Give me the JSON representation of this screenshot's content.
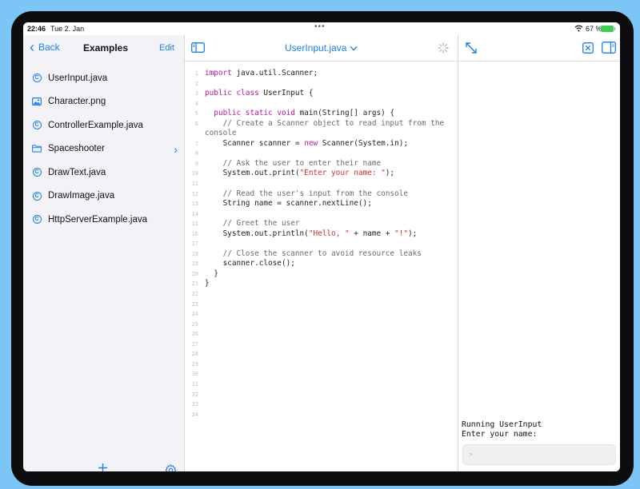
{
  "status_bar": {
    "time": "22:46",
    "date": "Tue 2. Jan",
    "multitask_dots": "•••",
    "battery_percent": "67 %",
    "battery_color": "#3ccf4e",
    "wifi_icon": "wifi-icon",
    "battery_icon": "battery-charging-icon"
  },
  "sidebar": {
    "back_label": "Back",
    "title": "Examples",
    "edit_label": "Edit",
    "items": [
      {
        "label": "UserInput.java",
        "icon": "java-class-icon"
      },
      {
        "label": "Character.png",
        "icon": "image-icon"
      },
      {
        "label": "ControllerExample.java",
        "icon": "java-class-icon"
      },
      {
        "label": "Spaceshooter",
        "icon": "folder-icon",
        "has_chevron": true
      },
      {
        "label": "DrawText.java",
        "icon": "java-class-icon"
      },
      {
        "label": "DrawImage.java",
        "icon": "java-class-icon"
      },
      {
        "label": "HttpServerExample.java",
        "icon": "java-class-icon"
      }
    ],
    "add_icon": "plus-icon",
    "settings_icon": "gear-icon"
  },
  "editor": {
    "filename": "UserInput.java",
    "lines": [
      {
        "n": "1",
        "html": "<span class=\"kw\">import</span> java.util.Scanner;"
      },
      {
        "n": "2",
        "html": ""
      },
      {
        "n": "3",
        "html": "<span class=\"kw\">public class</span> UserInput {"
      },
      {
        "n": "4",
        "html": ""
      },
      {
        "n": "5",
        "html": "  <span class=\"kw\">public static void</span> main(String[] args) {"
      },
      {
        "n": "6",
        "html": "<span class=\"cm\">    // Create a Scanner object to read input from the console</span>",
        "wrap": true
      },
      {
        "n": "7",
        "html": "    Scanner scanner = <span class=\"kw\">new</span> Scanner(System.in);"
      },
      {
        "n": "8",
        "html": ""
      },
      {
        "n": "9",
        "html": "<span class=\"cm\">    // Ask the user to enter their name</span>"
      },
      {
        "n": "10",
        "html": "    System.out.print(<span class=\"st\">\"Enter your name: \"</span>);"
      },
      {
        "n": "11",
        "html": ""
      },
      {
        "n": "12",
        "html": "<span class=\"cm\">    // Read the user's input from the console</span>"
      },
      {
        "n": "13",
        "html": "    String name = scanner.nextLine();"
      },
      {
        "n": "14",
        "html": ""
      },
      {
        "n": "15",
        "html": "<span class=\"cm\">    // Greet the user</span>"
      },
      {
        "n": "16",
        "html": "    System.out.println(<span class=\"st\">\"Hello, \"</span> + name + <span class=\"st\">\"!\"</span>);"
      },
      {
        "n": "17",
        "html": ""
      },
      {
        "n": "18",
        "html": "<span class=\"cm\">    // Close the scanner to avoid resource leaks</span>"
      },
      {
        "n": "19",
        "html": "    scanner.close();"
      },
      {
        "n": "20",
        "html": "  }"
      },
      {
        "n": "21",
        "html": "}"
      },
      {
        "n": "22",
        "html": ""
      },
      {
        "n": "23",
        "html": ""
      },
      {
        "n": "24",
        "html": ""
      },
      {
        "n": "25",
        "html": ""
      },
      {
        "n": "26",
        "html": ""
      },
      {
        "n": "27",
        "html": ""
      },
      {
        "n": "28",
        "html": ""
      },
      {
        "n": "29",
        "html": ""
      },
      {
        "n": "30",
        "html": ""
      },
      {
        "n": "31",
        "html": ""
      },
      {
        "n": "32",
        "html": ""
      },
      {
        "n": "33",
        "html": ""
      },
      {
        "n": "34",
        "html": ""
      }
    ]
  },
  "console": {
    "output": "Running UserInput\nEnter your name:",
    "input_prompt": ">",
    "expand_icon": "expand-arrows-icon",
    "clear_icon": "clear-console-icon",
    "panel_icon": "sidebar-right-icon"
  },
  "colors": {
    "accent": "#1c7ff0",
    "background": "#7cc6f7",
    "keyword": "#b5179e",
    "string": "#d12c2c",
    "comment": "#6a6a72"
  }
}
